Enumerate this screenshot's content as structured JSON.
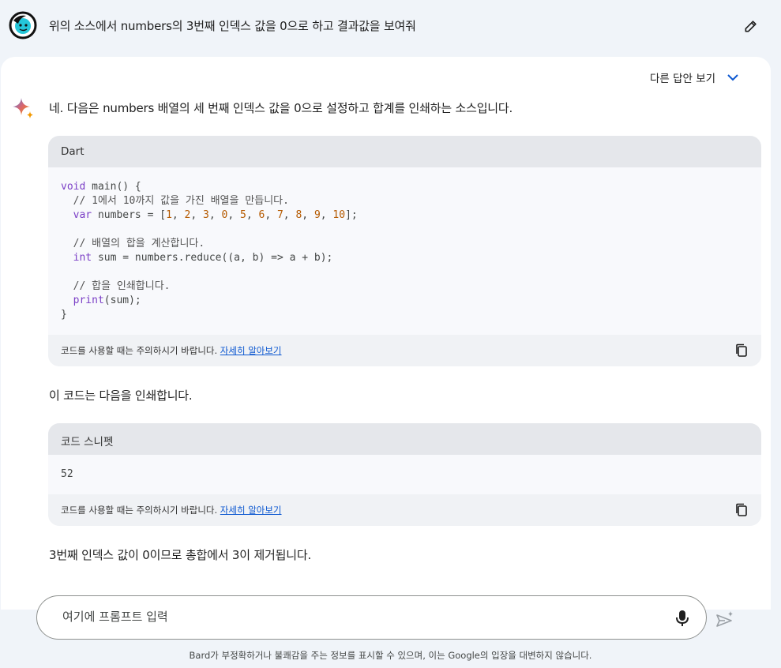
{
  "user": {
    "prompt": "위의 소스에서 numbers의 3번째 인덱스 값을 0으로 하고 결과값을 보여줘"
  },
  "response": {
    "drafts_label": "다른 답안 보기",
    "intro": "네. 다음은 numbers 배열의 세 번째 인덱스 값을 0으로 설정하고 합계를 인쇄하는 소스입니다.",
    "code_block_1": {
      "language": "Dart",
      "lines": [
        [
          {
            "t": "void",
            "c": "kw"
          },
          {
            "t": " main() {",
            "c": "fn"
          }
        ],
        [
          {
            "t": "  // 1에서 10까지 값을 가진 배열을 만듭니다.",
            "c": "cm"
          }
        ],
        [
          {
            "t": "  ",
            "c": "fn"
          },
          {
            "t": "var",
            "c": "kw"
          },
          {
            "t": " numbers = [",
            "c": "fn"
          },
          {
            "t": "1",
            "c": "num"
          },
          {
            "t": ", ",
            "c": "fn"
          },
          {
            "t": "2",
            "c": "num"
          },
          {
            "t": ", ",
            "c": "fn"
          },
          {
            "t": "3",
            "c": "num"
          },
          {
            "t": ", ",
            "c": "fn"
          },
          {
            "t": "0",
            "c": "num"
          },
          {
            "t": ", ",
            "c": "fn"
          },
          {
            "t": "5",
            "c": "num"
          },
          {
            "t": ", ",
            "c": "fn"
          },
          {
            "t": "6",
            "c": "num"
          },
          {
            "t": ", ",
            "c": "fn"
          },
          {
            "t": "7",
            "c": "num"
          },
          {
            "t": ", ",
            "c": "fn"
          },
          {
            "t": "8",
            "c": "num"
          },
          {
            "t": ", ",
            "c": "fn"
          },
          {
            "t": "9",
            "c": "num"
          },
          {
            "t": ", ",
            "c": "fn"
          },
          {
            "t": "10",
            "c": "num"
          },
          {
            "t": "];",
            "c": "fn"
          }
        ],
        [
          {
            "t": "",
            "c": "fn"
          }
        ],
        [
          {
            "t": "  // 배열의 합을 계산합니다.",
            "c": "cm"
          }
        ],
        [
          {
            "t": "  ",
            "c": "fn"
          },
          {
            "t": "int",
            "c": "kw"
          },
          {
            "t": " sum = numbers.reduce((a, b) => a + b);",
            "c": "fn"
          }
        ],
        [
          {
            "t": "",
            "c": "fn"
          }
        ],
        [
          {
            "t": "  // 합을 인쇄합니다.",
            "c": "cm"
          }
        ],
        [
          {
            "t": "  ",
            "c": "fn"
          },
          {
            "t": "print",
            "c": "kw"
          },
          {
            "t": "(sum);",
            "c": "fn"
          }
        ],
        [
          {
            "t": "}",
            "c": "fn"
          }
        ]
      ],
      "footer_text": "코드를 사용할 때는 주의하시기 바랍니다.",
      "footer_link": "자세히 알아보기"
    },
    "mid_text": "이 코드는 다음을 인쇄합니다.",
    "code_block_2": {
      "language": "코드 스니펫",
      "lines": [
        [
          {
            "t": "52",
            "c": "fn"
          }
        ]
      ],
      "footer_text": "코드를 사용할 때는 주의하시기 바랍니다.",
      "footer_link": "자세히 알아보기"
    },
    "final_text": "3번째 인덱스 값이 0이므로 총합에서 3이 제거됩니다."
  },
  "composer": {
    "placeholder": "여기에 프롬프트 입력"
  },
  "disclaimer": "Bard가 부정확하거나 불쾌감을 주는 정보를 표시할 수 있으며, 이는 Google의 입장을 대변하지 않습니다.",
  "colors": {
    "background": "#f0f4f9",
    "card": "#ffffff",
    "accent": "#0b57d0",
    "keyword": "#7b3fc6",
    "number": "#b55a00"
  }
}
